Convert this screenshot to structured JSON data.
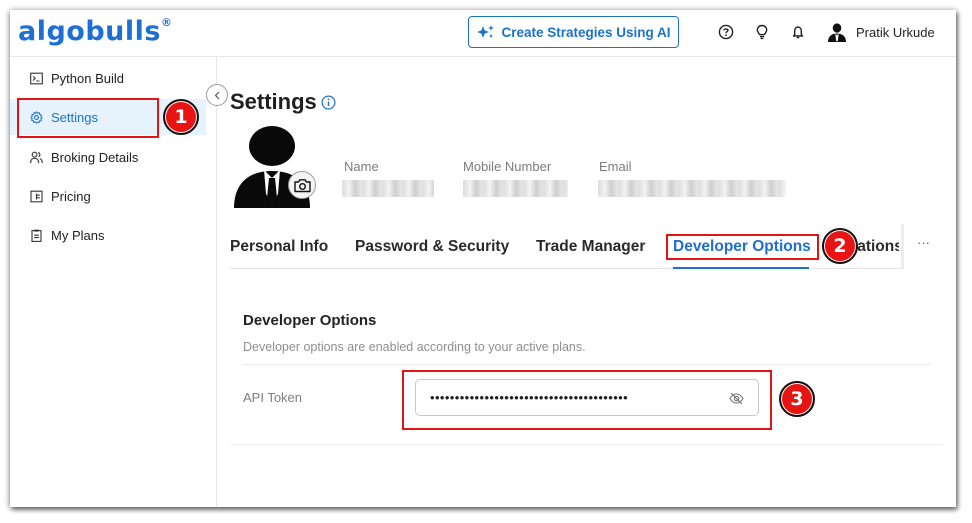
{
  "header": {
    "logo_text": "algobulls",
    "logo_mark": "®",
    "ai_button_label": "Create Strategies Using AI",
    "icons": [
      "help-circle-icon",
      "lightbulb-icon",
      "bell-icon"
    ],
    "user_name": "Pratik Urkude"
  },
  "sidebar": {
    "items": [
      {
        "label": "Python Build",
        "icon": "terminal-icon"
      },
      {
        "label": "Settings",
        "icon": "gear-icon",
        "active": true
      },
      {
        "label": "Broking Details",
        "icon": "users-icon"
      },
      {
        "label": "Pricing",
        "icon": "receipt-icon"
      },
      {
        "label": "My Plans",
        "icon": "clipboard-icon"
      }
    ]
  },
  "page": {
    "title": "Settings",
    "profile": {
      "name_label": "Name",
      "mobile_label": "Mobile Number",
      "email_label": "Email"
    },
    "tabs": [
      {
        "label": "Personal Info"
      },
      {
        "label": "Password & Security"
      },
      {
        "label": "Trade Manager"
      },
      {
        "label": "Developer Options",
        "active": true
      },
      {
        "label": "Notifications"
      }
    ],
    "tab_more": "···",
    "developer": {
      "title": "Developer Options",
      "description": "Developer options are enabled according to your active plans.",
      "api_label": "API Token",
      "api_value": "••••••••••••••••••••••••••••••••••••••••"
    }
  },
  "annotations": {
    "badges": [
      "1",
      "2",
      "3"
    ],
    "color": "#e31414"
  },
  "colors": {
    "brand": "#1d6fd1",
    "active_bg": "#e6f3fd"
  }
}
